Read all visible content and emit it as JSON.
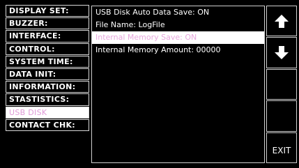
{
  "menu": {
    "items": [
      {
        "label": "DISPLAY SET:"
      },
      {
        "label": "BUZZER:"
      },
      {
        "label": "INTERFACE:"
      },
      {
        "label": "CONTROL:"
      },
      {
        "label": "SYSTEM TIME:"
      },
      {
        "label": "DATA INIT:"
      },
      {
        "label": "INFORMATION:"
      },
      {
        "label": "STASTISTICS:"
      },
      {
        "label": "USB DISK",
        "selected": true
      },
      {
        "label": "CONTACT CHK:"
      }
    ]
  },
  "panel": {
    "rows": [
      {
        "text": "USB Disk Auto Data Save: ON"
      },
      {
        "text": "File Name: LogFile"
      },
      {
        "text": "Internal Memory Save: ON",
        "highlighted": true
      },
      {
        "text": "Internal Memory Amount: 00000"
      }
    ]
  },
  "softkeys": {
    "up_icon": "arrow-up-icon",
    "down_icon": "arrow-down-icon",
    "exit_label": "EXIT"
  }
}
